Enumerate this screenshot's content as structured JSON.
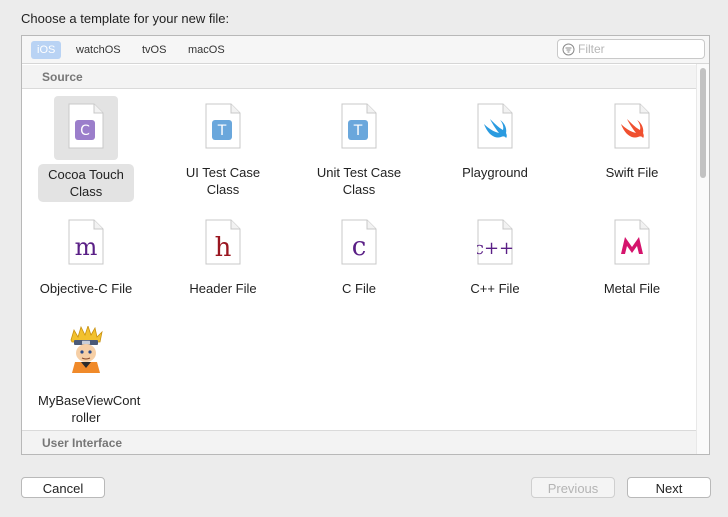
{
  "dialog": {
    "prompt": "Choose a template for your new file:"
  },
  "platform_tabs": [
    {
      "label": "iOS",
      "selected": true
    },
    {
      "label": "watchOS",
      "selected": false
    },
    {
      "label": "tvOS",
      "selected": false
    },
    {
      "label": "macOS",
      "selected": false
    }
  ],
  "filter": {
    "placeholder": "Filter",
    "value": ""
  },
  "sections": {
    "source": "Source",
    "user_interface": "User Interface"
  },
  "templates": [
    {
      "label": "Cocoa Touch Class",
      "icon": "cocoa-touch-class-icon",
      "selected": true
    },
    {
      "label": "UI Test Case Class",
      "icon": "ui-test-case-icon"
    },
    {
      "label": "Unit Test Case Class",
      "icon": "unit-test-case-icon"
    },
    {
      "label": "Playground",
      "icon": "swift-playground-icon"
    },
    {
      "label": "Swift File",
      "icon": "swift-file-icon"
    },
    {
      "label": "Objective-C File",
      "icon": "objective-c-file-icon"
    },
    {
      "label": "Header File",
      "icon": "header-file-icon"
    },
    {
      "label": "C File",
      "icon": "c-file-icon"
    },
    {
      "label": "C++ File",
      "icon": "cpp-file-icon"
    },
    {
      "label": "Metal File",
      "icon": "metal-file-icon"
    },
    {
      "label": "MyBaseViewController",
      "icon": "custom-template-avatar-icon"
    }
  ],
  "tile_labels": {
    "cocoa": "Cocoa Touch\nClass",
    "uitest": "UI Test Case\nClass",
    "unittest": "Unit Test Case\nClass",
    "custom": "MyBaseViewCont\nroller"
  },
  "buttons": {
    "cancel": "Cancel",
    "previous": "Previous",
    "next": "Next"
  },
  "colors": {
    "selected_tab": "#b9d3f4",
    "swift_orange": "#f0502f",
    "playground_blue": "#2a9be0",
    "c_purple": "#5a1f86",
    "header_red": "#9a1620",
    "metal_pink": "#d5146d",
    "class_badge": "#9b7ecb",
    "test_badge": "#6aa7dc"
  }
}
